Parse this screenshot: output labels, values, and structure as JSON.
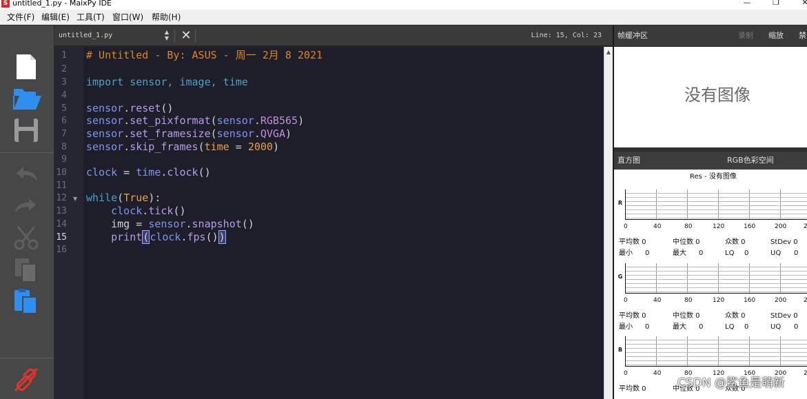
{
  "window": {
    "title": "untitled_1.py - MaixPy IDE",
    "logo_text": "S",
    "controls": {
      "minimize": "—",
      "maximize": "❐",
      "close": "✕"
    }
  },
  "menu": [
    "文件(F)",
    "编辑(E)",
    "工具(T)",
    "窗口(W)",
    "帮助(H)"
  ],
  "toolbar": {
    "items": [
      "new-file-icon",
      "open-folder-icon",
      "save-icon",
      "undo-icon",
      "redo-icon",
      "cut-icon",
      "copy-icon",
      "paste-icon",
      "disconnect-icon"
    ],
    "accent": "#2f8ff0",
    "connect_color": "#e0352b"
  },
  "editor": {
    "file_tab": "untitled_1.py",
    "cursor": "Line: 15, Col: 23",
    "current_line": 15,
    "line_numbers": [
      "1",
      "2",
      "3",
      "4",
      "5",
      "6",
      "7",
      "8",
      "9",
      "10",
      "11",
      "12",
      "13",
      "14",
      "15",
      "16"
    ]
  },
  "code": {
    "l1": "# Untitled - By: ASUS - 周一 2月 8 2021",
    "l3_kw": "import",
    "l3_rest": " sensor, image, time",
    "l5_obj": "sensor",
    "l5_fn": "reset",
    "l5_args": "()",
    "l6_obj": "sensor",
    "l6_fn": "set_pixformat",
    "l6_a1": "sensor",
    "l6_a2": "RGB565",
    "l7_obj": "sensor",
    "l7_fn": "set_framesize",
    "l7_a1": "sensor",
    "l7_a2": "QVGA",
    "l8_obj": "sensor",
    "l8_fn": "skip_frames",
    "l8_kw": "time",
    "l8_eq": " = ",
    "l8_num": "2000",
    "l10_var": "clock",
    "l10_eq": " = ",
    "l10_obj": "time",
    "l10_fn": "clock",
    "l10_args": "()",
    "l12_kw": "while",
    "l12_arg": "True",
    "l12_end": ":",
    "l13_ind": "    ",
    "l13_obj": "clock",
    "l13_fn": "tick",
    "l13_args": "()",
    "l14_ind": "    ",
    "l14_var": "img",
    "l14_eq": " = ",
    "l14_obj": "sensor",
    "l14_fn": "snapshot",
    "l14_args": "()",
    "l15_ind": "    ",
    "l15_fn": "print",
    "l15_open": "(",
    "l15_mid1": "clock",
    "l15_mid2": "fps",
    "l15_mid3": "()",
    "l15_close": ")"
  },
  "framebuffer": {
    "title": "帧缓冲区",
    "record": "录制",
    "zoom": "缩放",
    "disable": "禁",
    "placeholder": "没有图像"
  },
  "histogram": {
    "title": "直方图",
    "color_space": "RGB色彩空间",
    "resolution": "Res - 没有图像",
    "x_ticks": [
      "0",
      "40",
      "80",
      "120",
      "160",
      "200",
      "2"
    ],
    "channels": [
      {
        "label": "R",
        "mean_label": "平均数 0",
        "median_label": "中位数 0",
        "mode_label": "众数 0",
        "stdev_label": "StDev 0",
        "min_label": "最小",
        "min": "0",
        "max_label": "最大",
        "max": "0",
        "lq_label": "LQ",
        "lq": "0",
        "uq_label": "UQ",
        "uq": "0"
      },
      {
        "label": "G",
        "mean_label": "平均数 0",
        "median_label": "中位数 0",
        "mode_label": "众数 0",
        "stdev_label": "StDev 0",
        "min_label": "最小",
        "min": "0",
        "max_label": "最大",
        "max": "0",
        "lq_label": "LQ",
        "lq": "0",
        "uq_label": "UQ",
        "uq": "0"
      },
      {
        "label": "B",
        "mean_label": "平均数 0",
        "median_label": "中位数 0",
        "mode_label": "众数 0"
      }
    ]
  },
  "watermark": "CSDN @鲨鱼是萌新"
}
